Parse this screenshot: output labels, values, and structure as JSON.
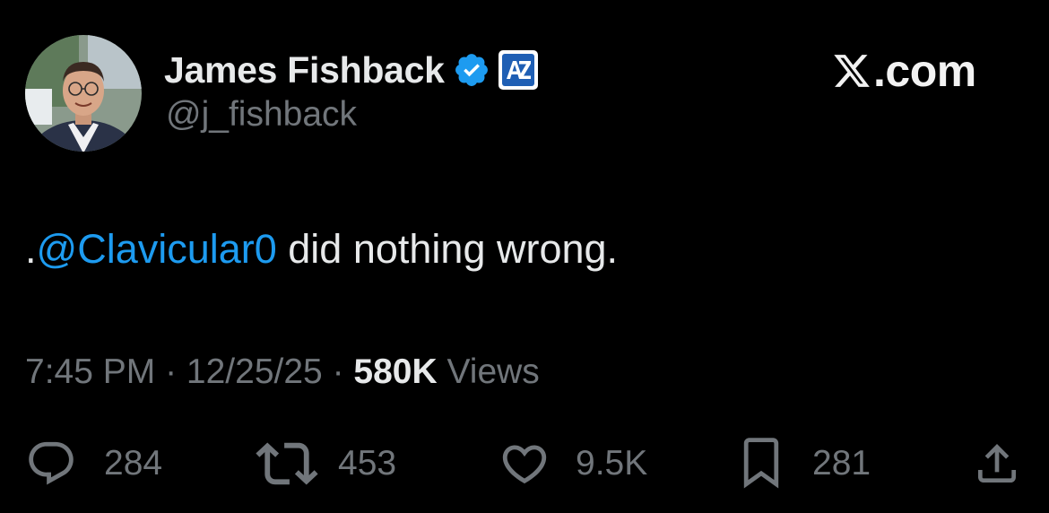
{
  "author": {
    "display_name": "James Fishback",
    "handle": "@j_fishback",
    "verified_icon": "verified-badge-icon",
    "affiliation_badge": "az-affiliation-badge"
  },
  "brand": {
    "logo_icon": "x-logo-icon",
    "domain": ".com"
  },
  "tweet": {
    "prefix": ".",
    "mention": "@Clavicular0",
    "body": " did nothing wrong."
  },
  "meta": {
    "time": "7:45 PM",
    "separator": " · ",
    "date": "12/25/25",
    "views_count": "580K",
    "views_label": " Views"
  },
  "actions": {
    "replies": {
      "icon": "reply-icon",
      "count": "284"
    },
    "reposts": {
      "icon": "repost-icon",
      "count": "453"
    },
    "likes": {
      "icon": "heart-icon",
      "count": "9.5K"
    },
    "bookmarks": {
      "icon": "bookmark-icon",
      "count": "281"
    },
    "share": {
      "icon": "share-icon"
    }
  },
  "colors": {
    "background": "#000000",
    "primary_text": "#e7e9ea",
    "secondary_text": "#71767b",
    "link": "#1d9bf0",
    "verified": "#1d9bf0",
    "badge_bg": "#1f5fb4"
  }
}
